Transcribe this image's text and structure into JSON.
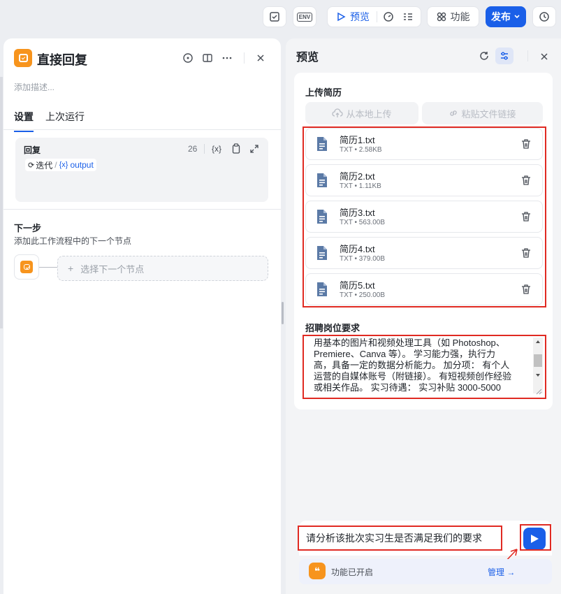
{
  "toolbar": {
    "env_label": "ENV",
    "preview_label": "预览",
    "feature_label": "功能",
    "publish_label": "发布"
  },
  "left": {
    "title": "直接回复",
    "description_placeholder": "添加描述...",
    "tabs": [
      "设置",
      "上次运行"
    ],
    "reply": {
      "label": "回复",
      "count": "26",
      "var_chip": "{x}",
      "iter_chip": "迭代",
      "separator": "/",
      "output_chip": "output"
    },
    "next": {
      "title": "下一步",
      "desc": "添加此工作流程中的下一个节点",
      "select_placeholder": "选择下一个节点",
      "plus": "+"
    }
  },
  "right": {
    "title": "预览",
    "upload_title": "上传简历",
    "upload_local": "从本地上传",
    "paste_link": "粘贴文件链接",
    "files": [
      {
        "name": "简历1.txt",
        "meta": "TXT • 2.58KB"
      },
      {
        "name": "简历2.txt",
        "meta": "TXT • 1.11KB"
      },
      {
        "name": "简历3.txt",
        "meta": "TXT • 563.00B"
      },
      {
        "name": "简历4.txt",
        "meta": "TXT • 379.00B"
      },
      {
        "name": "简历5.txt",
        "meta": "TXT • 250.00B"
      }
    ],
    "requirements_title": "招聘岗位要求",
    "requirements_lines": [
      "用基本的图片和视频处理工具（如 Photoshop、",
      "Premiere、Canva 等）。 学习能力强，执行力",
      "高，具备一定的数据分析能力。 加分项： 有个人",
      "运营的自媒体账号（附链接）。 有短视频创作经验",
      "或相关作品。 实习待遇： 实习补贴 3000-5000"
    ],
    "chat_input": "请分析该批次实习生是否满足我们的要求",
    "feature_status": "功能已开启",
    "manage": "管理 →"
  },
  "colors": {
    "accent": "#1a5fe8",
    "node_orange": "#f7941d",
    "highlight_red": "#e02a22"
  }
}
